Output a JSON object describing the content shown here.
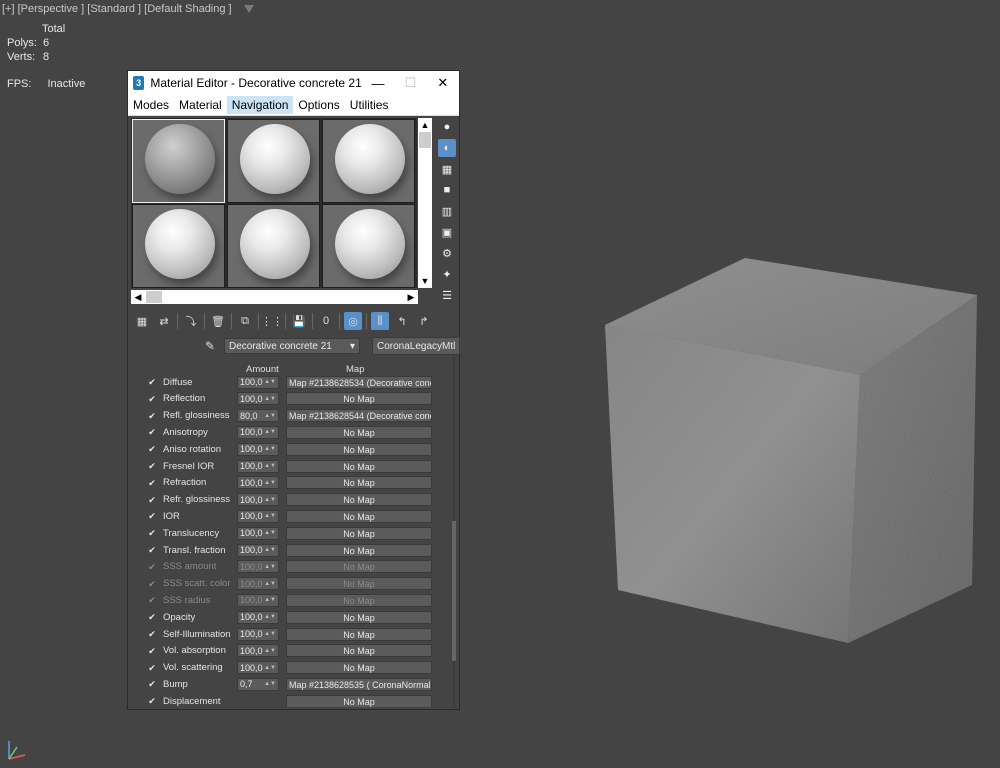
{
  "viewport": {
    "label": "[+] [Perspective ] [Standard ] [Default Shading ]",
    "stats": {
      "header": "Total",
      "polys_label": "Polys:",
      "polys": "6",
      "verts_label": "Verts:",
      "verts": "8"
    },
    "fps_label": "FPS:",
    "fps_value": "Inactive"
  },
  "window": {
    "icon": "3",
    "title": "Material Editor - Decorative concrete 21",
    "minimize": "—",
    "maximize": "☐",
    "close": "✕"
  },
  "menu": {
    "items": [
      "Modes",
      "Material",
      "Navigation",
      "Options",
      "Utilities"
    ],
    "active": "Navigation"
  },
  "material_name": "Decorative concrete 21",
  "material_type": "CoronaLegacyMtl",
  "params_header": {
    "amount": "Amount",
    "map": "Map"
  },
  "params": [
    {
      "label": "Diffuse",
      "amount": "100,0",
      "map": "Map #2138628534 (Decorative conc",
      "enabled": true
    },
    {
      "label": "Reflection",
      "amount": "100,0",
      "map": "No Map",
      "enabled": true
    },
    {
      "label": "Refl. glossiness",
      "amount": "80,0",
      "map": "Map #2138628544 (Decorative conc",
      "enabled": true
    },
    {
      "label": "Anisotropy",
      "amount": "100,0",
      "map": "No Map",
      "enabled": true
    },
    {
      "label": "Aniso rotation",
      "amount": "100,0",
      "map": "No Map",
      "enabled": true
    },
    {
      "label": "Fresnel IOR",
      "amount": "100,0",
      "map": "No Map",
      "enabled": true
    },
    {
      "label": "Refraction",
      "amount": "100,0",
      "map": "No Map",
      "enabled": true
    },
    {
      "label": "Refr. glossiness",
      "amount": "100,0",
      "map": "No Map",
      "enabled": true
    },
    {
      "label": "IOR",
      "amount": "100,0",
      "map": "No Map",
      "enabled": true
    },
    {
      "label": "Translucency",
      "amount": "100,0",
      "map": "No Map",
      "enabled": true
    },
    {
      "label": "Transl. fraction",
      "amount": "100,0",
      "map": "No Map",
      "enabled": true
    },
    {
      "label": "SSS amount",
      "amount": "100,0",
      "map": "No Map",
      "enabled": false
    },
    {
      "label": "SSS scatt. color",
      "amount": "100,0",
      "map": "No Map",
      "enabled": false
    },
    {
      "label": "SSS radius",
      "amount": "100,0",
      "map": "No Map",
      "enabled": false
    },
    {
      "label": "Opacity",
      "amount": "100,0",
      "map": "No Map",
      "enabled": true
    },
    {
      "label": "Self-Illumination",
      "amount": "100,0",
      "map": "No Map",
      "enabled": true
    },
    {
      "label": "Vol. absorption",
      "amount": "100,0",
      "map": "No Map",
      "enabled": true
    },
    {
      "label": "Vol. scattering",
      "amount": "100,0",
      "map": "No Map",
      "enabled": true
    },
    {
      "label": "Bump",
      "amount": "0,7",
      "map": "Map #2138628535  ( CoronaNormal",
      "enabled": true
    },
    {
      "label": "Displacement",
      "amount": "",
      "map": "No Map",
      "enabled": true
    }
  ]
}
